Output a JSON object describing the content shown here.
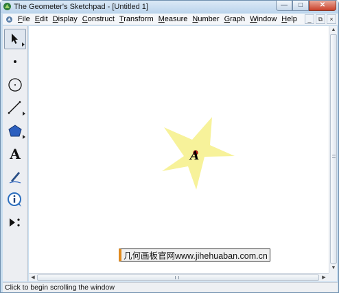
{
  "window": {
    "title": "The Geometer's Sketchpad - [Untitled 1]",
    "minimize_icon": "minimize-icon",
    "maximize_icon": "maximize-icon",
    "close_icon": "close-icon",
    "close_color": "#c9402a"
  },
  "menubar": {
    "items": [
      {
        "label": "File"
      },
      {
        "label": "Edit"
      },
      {
        "label": "Display"
      },
      {
        "label": "Construct"
      },
      {
        "label": "Transform"
      },
      {
        "label": "Measure"
      },
      {
        "label": "Number"
      },
      {
        "label": "Graph"
      },
      {
        "label": "Window"
      },
      {
        "label": "Help"
      }
    ]
  },
  "toolbox": {
    "tools": [
      {
        "name": "selection-arrow-tool",
        "icon": "arrow-icon",
        "selected": true
      },
      {
        "name": "point-tool",
        "icon": "point-icon"
      },
      {
        "name": "compass-tool",
        "icon": "circle-icon"
      },
      {
        "name": "straightedge-tool",
        "icon": "segment-icon"
      },
      {
        "name": "polygon-tool",
        "icon": "pentagon-icon"
      },
      {
        "name": "text-tool",
        "icon": "text-a-icon",
        "label": "A"
      },
      {
        "name": "marker-tool",
        "icon": "pen-icon"
      },
      {
        "name": "information-tool",
        "icon": "info-icon"
      },
      {
        "name": "custom-tool",
        "icon": "play-dots-icon"
      }
    ]
  },
  "canvas": {
    "shape": "star",
    "shape_color": "#f7f29a",
    "point_color": "#e01b1b",
    "point_label": "A"
  },
  "watermark": {
    "text": "几何画板官网www.jihehuaban.com.cn",
    "accent_color": "#e08a1e"
  },
  "statusbar": {
    "text": "Click to begin scrolling the window"
  }
}
